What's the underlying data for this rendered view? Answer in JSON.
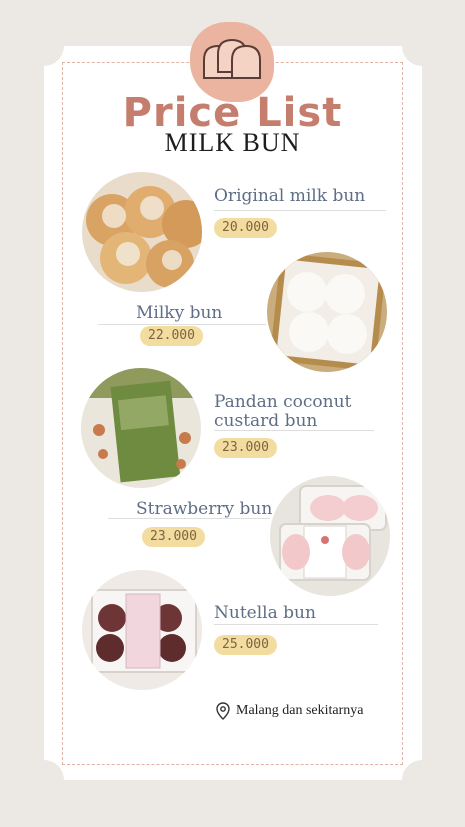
{
  "header": {
    "title": "Price List",
    "subtitle": "MILK BUN"
  },
  "items": [
    {
      "name": "Original milk bun",
      "price": "20.000",
      "image": "milk bun photo"
    },
    {
      "name": "Milky bun",
      "price": "22.000",
      "image": "milky bun tray photo"
    },
    {
      "name": "Pandan coconut custard bun",
      "price": "23.000",
      "image": "pandan custard bun package photo"
    },
    {
      "name": "Strawberry bun",
      "price": "23.000",
      "image": "strawberry bun box photo"
    },
    {
      "name": "Nutella bun",
      "price": "25.000",
      "image": "nutella bun box photo"
    }
  ],
  "location": {
    "text": "Malang dan sekitarnya",
    "icon": "map-pin-icon"
  },
  "colors": {
    "accent": "#c57e6e",
    "badge": "#ebb4a0",
    "price_pill": "#f3dc9f",
    "item_text": "#5e6e86",
    "background": "#ece9e4"
  }
}
